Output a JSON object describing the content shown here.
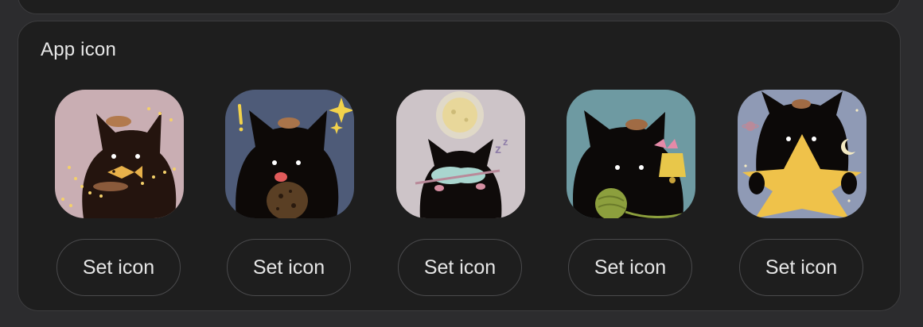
{
  "section": {
    "title": "App icon"
  },
  "icons": [
    {
      "name": "cat-with-fish",
      "bg": "#c9aeb3",
      "button_label": "Set icon"
    },
    {
      "name": "cat-with-cookie",
      "bg": "#4e5b78",
      "button_label": "Set icon"
    },
    {
      "name": "cat-sleeping",
      "bg": "#cdc4c8",
      "button_label": "Set icon"
    },
    {
      "name": "cat-with-yarn",
      "bg": "#6e9aa2",
      "button_label": "Set icon"
    },
    {
      "name": "cat-with-star",
      "bg": "#8f9ab5",
      "button_label": "Set icon"
    }
  ]
}
